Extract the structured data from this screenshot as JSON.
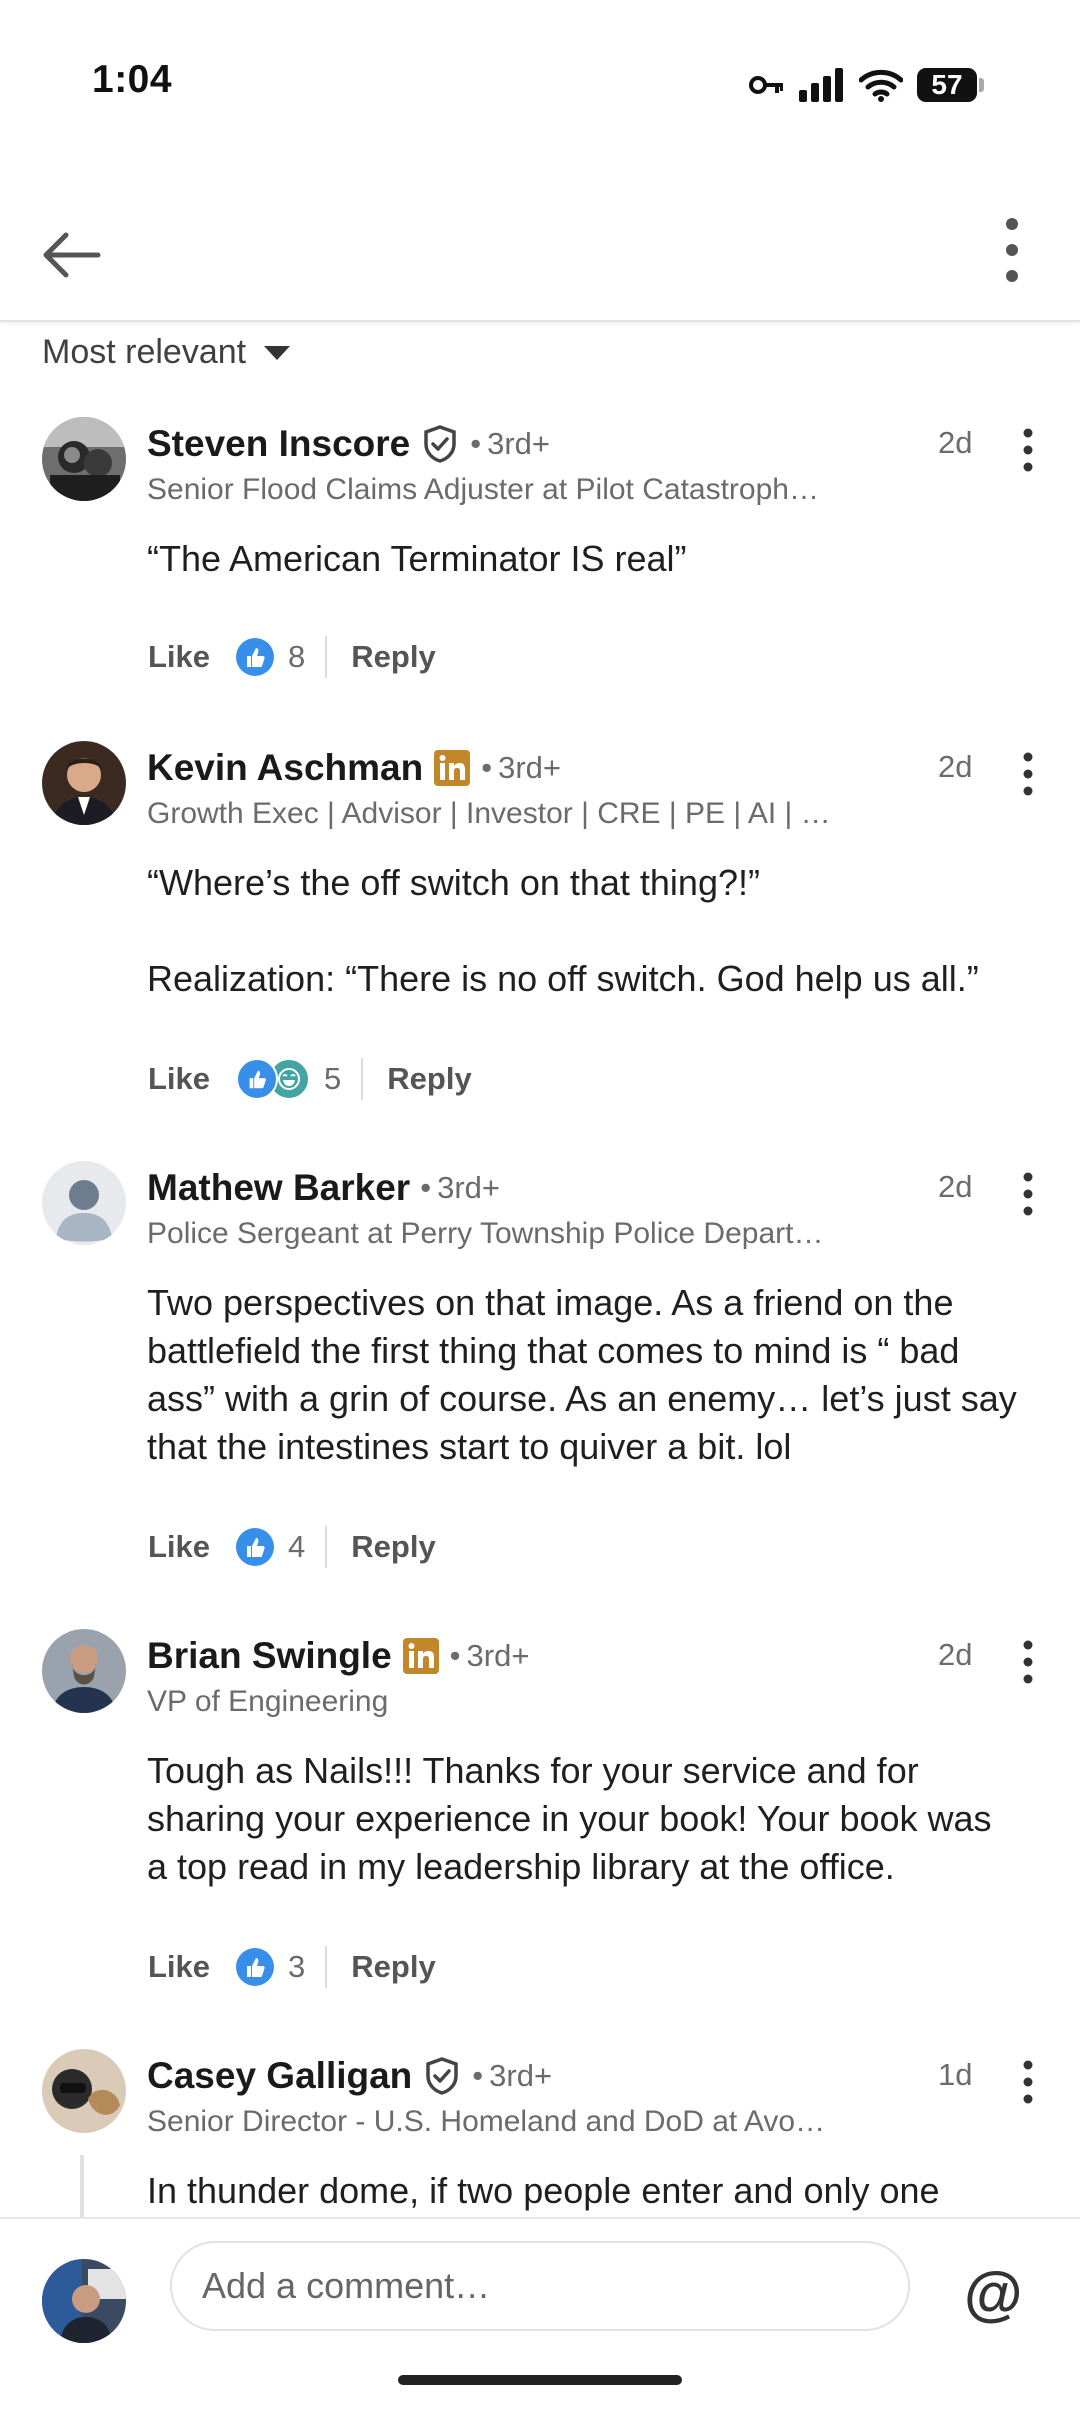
{
  "status_bar": {
    "time": "1:04",
    "battery": "57",
    "icons": [
      "key-icon",
      "signal-icon",
      "wifi-icon",
      "battery-icon"
    ]
  },
  "header": {
    "back_icon": "arrow-left-icon",
    "more_icon": "more-vertical-icon"
  },
  "sort": {
    "label": "Most relevant",
    "icon": "caret-down-icon"
  },
  "comments": [
    {
      "author": "Steven Inscore",
      "badge": "verified",
      "degree": "3rd+",
      "dot": "•",
      "headline": "Senior Flood Claims Adjuster at Pilot Catastroph…",
      "time": "2d",
      "text": [
        "“The American Terminator IS real”"
      ],
      "like_label": "Like",
      "reaction_count": "8",
      "reply_label": "Reply"
    },
    {
      "author": "Kevin Aschman",
      "badge": "linkedin",
      "degree": "3rd+",
      "dot": "•",
      "headline": "Growth Exec | Advisor | Investor | CRE | PE | AI | …",
      "time": "2d",
      "text": [
        "“Where’s the off switch on that thing?!”",
        "",
        "Realization: “There is no off switch. God help us all.”"
      ],
      "like_label": "Like",
      "reaction_count": "5",
      "reply_label": "Reply"
    },
    {
      "author": "Mathew Barker",
      "badge": "",
      "degree": "3rd+",
      "dot": "•",
      "headline": "Police Sergeant at Perry Township Police Depart…",
      "time": "2d",
      "text": [
        "Two perspectives on that image. As a friend on the",
        "battlefield the first thing that comes to mind is “ bad",
        "ass” with a grin of course. As an enemy… let’s just say",
        "that the intestines start to quiver a bit. lol"
      ],
      "like_label": "Like",
      "reaction_count": "4",
      "reply_label": "Reply"
    },
    {
      "author": "Brian Swingle",
      "badge": "linkedin",
      "degree": "3rd+",
      "dot": "•",
      "headline": "VP of Engineering",
      "time": "2d",
      "text": [
        "Tough as Nails!!! Thanks for your service and for",
        "sharing your experience in your book! Your book was",
        "a top read in my leadership library at the office."
      ],
      "like_label": "Like",
      "reaction_count": "3",
      "reply_label": "Reply"
    },
    {
      "author": "Casey Galligan",
      "badge": "verified",
      "degree": "3rd+",
      "dot": "•",
      "headline": "Senior Director - U.S. Homeland and DoD at Avo…",
      "time": "1d",
      "text": [
        "In thunder dome, if two people enter and only one"
      ]
    }
  ],
  "composer": {
    "placeholder": "Add a comment…",
    "mention_symbol": "@"
  },
  "colors": {
    "linkedin_badge": "#C3872B",
    "like_blue": "#378FE9",
    "laugh_green": "#44A3A3"
  }
}
